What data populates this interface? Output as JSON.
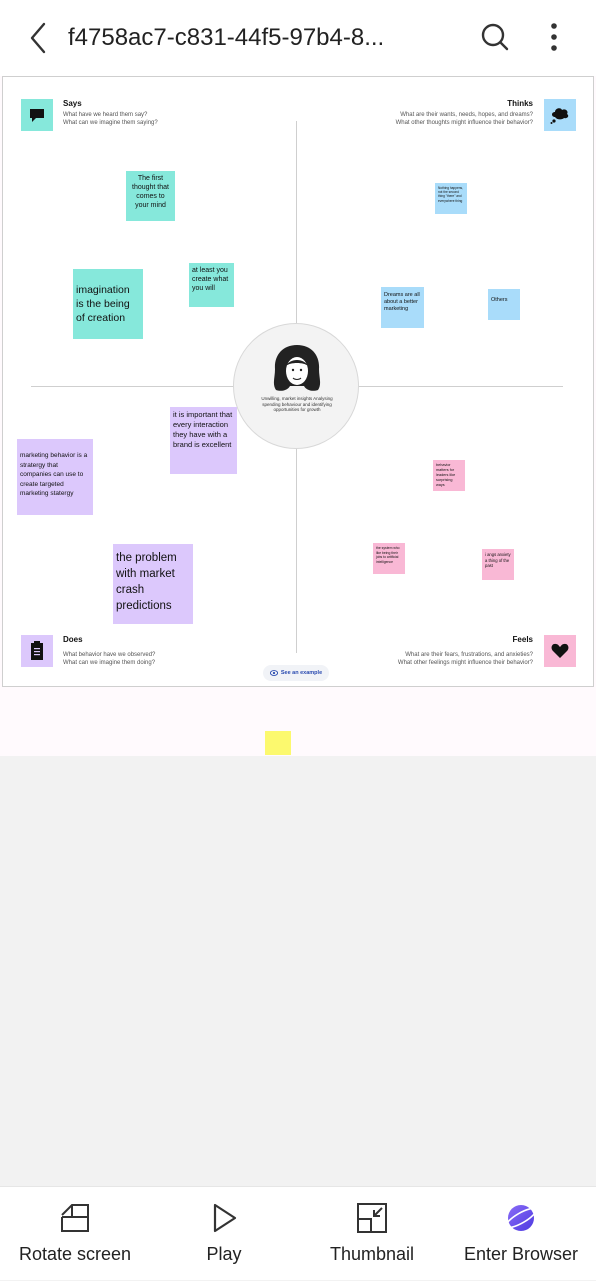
{
  "header": {
    "title": "f4758ac7-c831-44f5-97b4-8..."
  },
  "board": {
    "center_text": "Unwilling, market insights Analysing spending behaviour and identifying opportunities for growth",
    "example_link": "See an example",
    "quadrants": {
      "says": {
        "title": "Says",
        "line1": "What have we heard them say?",
        "line2": "What can we imagine them saying?",
        "icon": "speech-bubble-icon",
        "color": "#86e8db"
      },
      "thinks": {
        "title": "Thinks",
        "line1": "What are their wants, needs, hopes, and dreams?",
        "line2": "What other thoughts might influence their behavior?",
        "icon": "thought-cloud-icon",
        "color": "#a9dcfa"
      },
      "does": {
        "title": "Does",
        "line1": "What behavior have we observed?",
        "line2": "What can we imagine them doing?",
        "icon": "clipboard-icon",
        "color": "#dcc8fc"
      },
      "feels": {
        "title": "Feels",
        "line1": "What are their fears, frustrations, and anxieties?",
        "line2": "What other feelings might influence their behavior?",
        "icon": "heart-icon",
        "color": "#f9b8d5"
      }
    },
    "notes": {
      "says": [
        "The first thought that comes to your mind",
        "at least you create what you will",
        "imagination is the being of creation"
      ],
      "thinks": [
        "Nothing happens, not the second thing \"there\" and everywhere thing",
        "Dreams are all about a better marketing",
        "Others"
      ],
      "does": [
        "it is important that every interaction they have with a brand is excellent",
        "marketing behavior is a stratergy that companies can use to create targeted marketing statergy",
        "the problem with market crash predictions"
      ],
      "feels": [
        "behavior matters for leaders like surprising ways",
        "the system who like being their jobs to artificial intelligence",
        "i angs anxiety a thing of the past"
      ]
    }
  },
  "bottom_bar": {
    "rotate": "Rotate screen",
    "play": "Play",
    "thumbnail": "Thumbnail",
    "browser": "Enter Browser"
  }
}
